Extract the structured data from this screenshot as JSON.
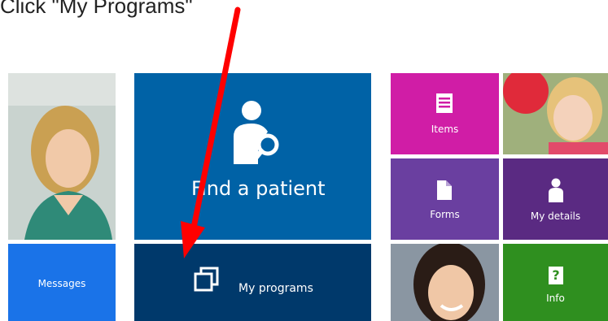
{
  "instruction": "Click \"My Programs\"",
  "tiles": {
    "find_patient": {
      "label": "Find a patient",
      "color": "#0062a6"
    },
    "my_programs": {
      "label": "My programs",
      "color": "#00396b"
    },
    "messages": {
      "label": "Messages",
      "color": "#1a73e8"
    },
    "items": {
      "label": "Items",
      "color": "#d01da6"
    },
    "forms": {
      "label": "Forms",
      "color": "#6a3fa0"
    },
    "my_details": {
      "label": "My details",
      "color": "#5a2a82"
    },
    "info": {
      "label": "Info",
      "color": "#2f8f1f",
      "icon_glyph": "?"
    }
  },
  "icons": {
    "find_patient": "person-search-icon",
    "my_programs": "copy-windows-icon",
    "items": "document-list-icon",
    "forms": "document-icon",
    "my_details": "person-icon",
    "info": "question-icon"
  },
  "annotation": {
    "arrow_color": "#ff0000"
  }
}
